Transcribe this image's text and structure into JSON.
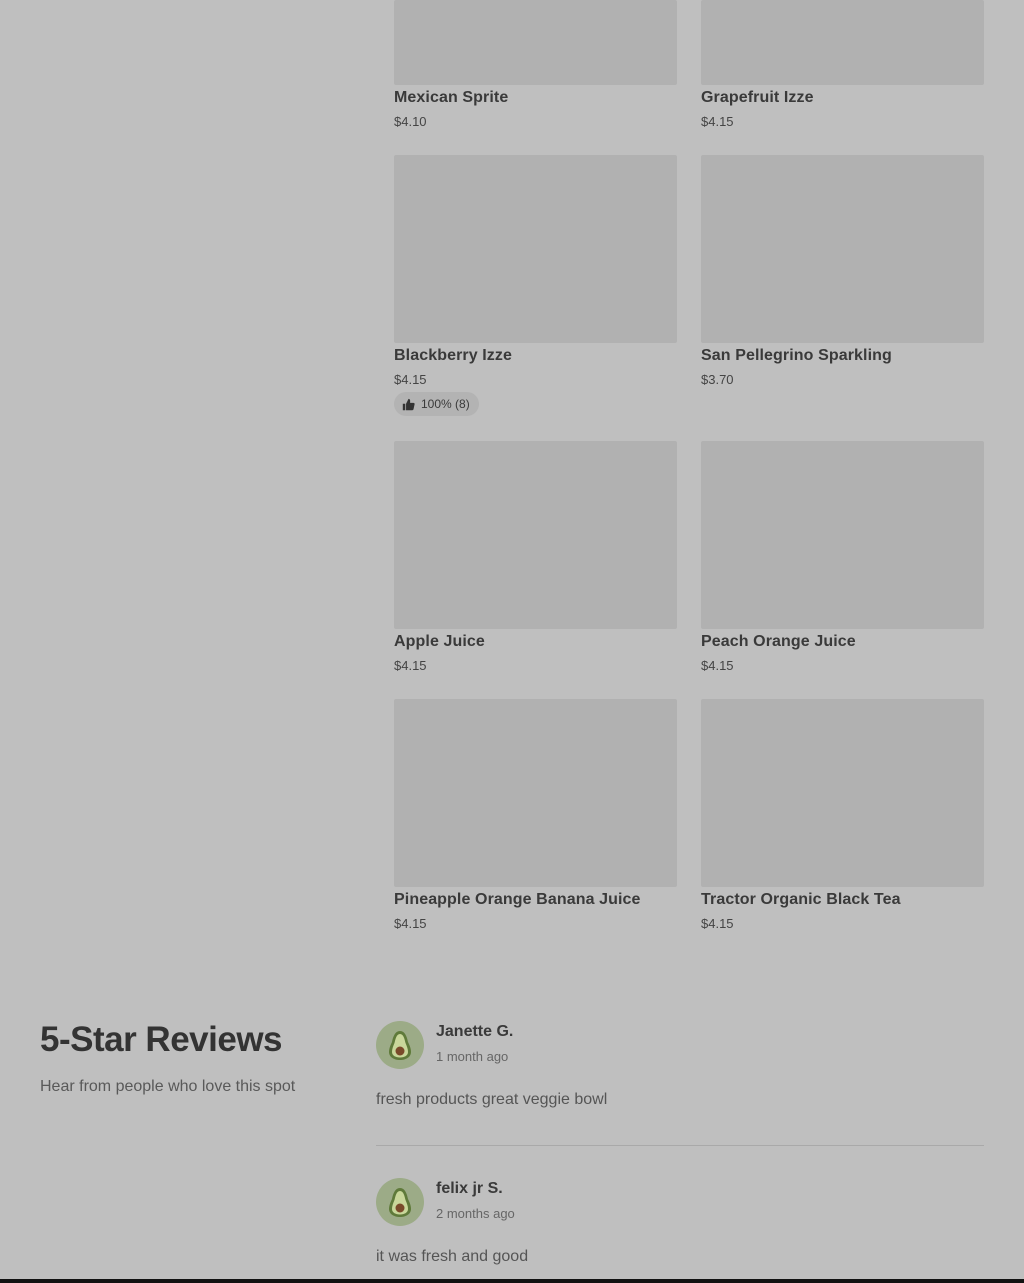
{
  "menu_items": [
    {
      "name": "Mexican Sprite",
      "price": "$4.10"
    },
    {
      "name": "Grapefruit Izze",
      "price": "$4.15"
    },
    {
      "name": "Blackberry Izze",
      "price": "$4.15",
      "rating": "100% (8)"
    },
    {
      "name": "San Pellegrino Sparkling",
      "price": "$3.70"
    },
    {
      "name": "Apple Juice",
      "price": "$4.15"
    },
    {
      "name": "Peach Orange Juice",
      "price": "$4.15"
    },
    {
      "name": "Pineapple Orange Banana Juice",
      "price": "$4.15"
    },
    {
      "name": "Tractor Organic Black Tea",
      "price": "$4.15"
    }
  ],
  "reviews_section": {
    "title": "5-Star Reviews",
    "subtitle": "Hear from people who love this spot",
    "reviews": [
      {
        "author": "Janette G.",
        "date": "1 month ago",
        "text": "fresh products great veggie bowl",
        "avatar_icon": "avocado-icon"
      },
      {
        "author": "felix jr S.",
        "date": "2 months ago",
        "text": "it was fresh and good",
        "avatar_icon": "avocado-icon"
      }
    ]
  },
  "colors": {
    "background": "#bfbfbf",
    "image_placeholder": "#b1b1b1",
    "avatar_bg": "#9cab87"
  }
}
